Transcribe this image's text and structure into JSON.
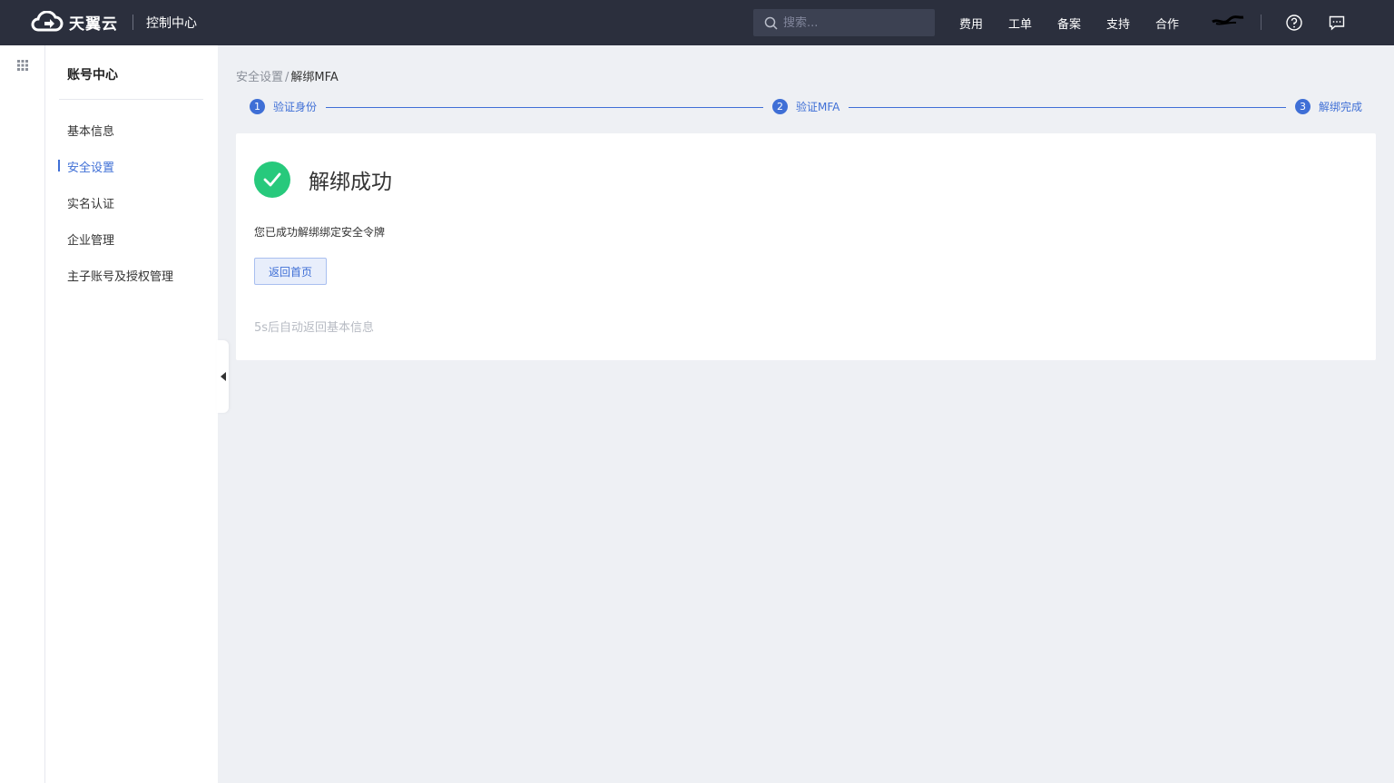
{
  "header": {
    "brand": "天翼云",
    "console_title": "控制中心",
    "search_placeholder": "搜索...",
    "nav": [
      "费用",
      "工单",
      "备案",
      "支持",
      "合作"
    ]
  },
  "sidebar": {
    "title": "账号中心",
    "items": [
      {
        "label": "基本信息",
        "active": false
      },
      {
        "label": "安全设置",
        "active": true
      },
      {
        "label": "实名认证",
        "active": false
      },
      {
        "label": "企业管理",
        "active": false
      },
      {
        "label": "主子账号及授权管理",
        "active": false
      }
    ]
  },
  "breadcrumb": {
    "parent": "安全设置",
    "separator": "/",
    "current": "解绑MFA"
  },
  "steps": [
    {
      "number": "1",
      "label": "验证身份"
    },
    {
      "number": "2",
      "label": "验证MFA"
    },
    {
      "number": "3",
      "label": "解绑完成"
    }
  ],
  "result": {
    "title": "解绑成功",
    "description": "您已成功解绑绑定安全令牌",
    "button_label": "返回首页",
    "countdown_text": "5s后自动返回基本信息"
  },
  "colors": {
    "topbar": "#2b2f3d",
    "accent": "#3f6fd6",
    "success": "#27c97c",
    "page_bg": "#eef0f4"
  },
  "icons": [
    "cloud-logo-icon",
    "search-icon",
    "help-icon",
    "message-icon",
    "app-grid-icon",
    "check-icon",
    "caret-left-icon"
  ]
}
